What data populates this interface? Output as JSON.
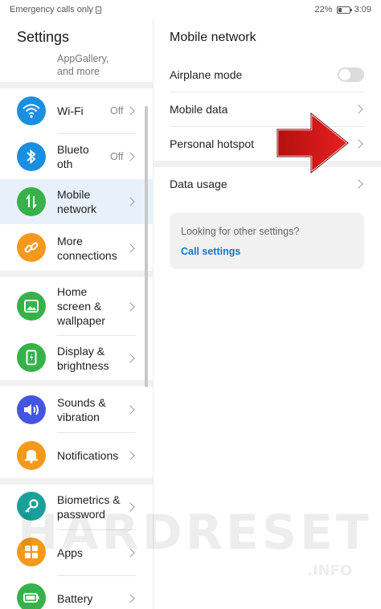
{
  "status_bar": {
    "left_text": "Emergency calls only",
    "battery": "22%",
    "time": "3:09"
  },
  "left": {
    "title": "Settings",
    "partial_item": [
      "AppGallery,",
      "and more"
    ],
    "items": [
      {
        "id": "wifi",
        "label": [
          "Wi-Fi"
        ],
        "value": "Off",
        "icon": "wifi-icon",
        "color": "#1a8fe0"
      },
      {
        "id": "bluetooth",
        "label": [
          "Blueto",
          "oth"
        ],
        "value": "Off",
        "icon": "bluetooth-icon",
        "color": "#1a8fe0"
      },
      {
        "id": "mobile-network",
        "label": [
          "Mobile",
          "network"
        ],
        "value": "",
        "icon": "mobile-network-icon",
        "color": "#35b24a",
        "selected": true
      },
      {
        "id": "more-connections",
        "label": [
          "More",
          "connections"
        ],
        "value": "",
        "icon": "link-icon",
        "color": "#f39a1c"
      },
      {
        "id": "home-screen",
        "label": [
          "Home",
          "screen &",
          "wallpaper"
        ],
        "value": "",
        "icon": "image-icon",
        "color": "#35b24a"
      },
      {
        "id": "display",
        "label": [
          "Display &",
          "brightness"
        ],
        "value": "",
        "icon": "display-icon",
        "color": "#35b24a"
      },
      {
        "id": "sounds",
        "label": [
          "Sounds &",
          "vibration"
        ],
        "value": "",
        "icon": "speaker-icon",
        "color": "#4455e0"
      },
      {
        "id": "notifications",
        "label": [
          "Notifications"
        ],
        "value": "",
        "icon": "bell-icon",
        "color": "#f39a1c"
      },
      {
        "id": "biometrics",
        "label": [
          "Biometrics &",
          "password"
        ],
        "value": "",
        "icon": "key-icon",
        "color": "#1aa09a"
      },
      {
        "id": "apps",
        "label": [
          "Apps"
        ],
        "value": "",
        "icon": "apps-icon",
        "color": "#f39a1c"
      },
      {
        "id": "battery",
        "label": [
          "Battery"
        ],
        "value": "",
        "icon": "battery-icon",
        "color": "#35b24a"
      }
    ]
  },
  "right": {
    "title": "Mobile network",
    "rows": [
      {
        "id": "airplane-mode",
        "label": "Airplane mode",
        "control": "toggle",
        "toggle_on": false
      },
      {
        "id": "mobile-data",
        "label": "Mobile data",
        "control": "chevron"
      },
      {
        "id": "personal-hotspot",
        "label": "Personal hotspot",
        "control": "chevron"
      },
      {
        "id": "data-usage",
        "label": "Data usage",
        "control": "chevron"
      }
    ],
    "suggestion": {
      "text": "Looking for other settings?",
      "link": "Call settings"
    }
  },
  "watermark": {
    "main": "HARDRESET",
    "sub": ".INFO"
  },
  "colors": {
    "accent": "#1a73c9",
    "arrow": "#e01818",
    "selected_bg": "#e8f1fb"
  }
}
